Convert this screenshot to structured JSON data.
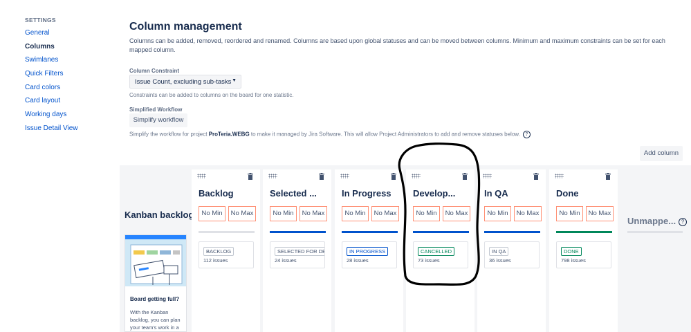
{
  "sidebar": {
    "heading": "SETTINGS",
    "items": [
      {
        "label": "General"
      },
      {
        "label": "Columns"
      },
      {
        "label": "Swimlanes"
      },
      {
        "label": "Quick Filters"
      },
      {
        "label": "Card colors"
      },
      {
        "label": "Card layout"
      },
      {
        "label": "Working days"
      },
      {
        "label": "Issue Detail View"
      }
    ]
  },
  "page": {
    "title": "Column management",
    "description": "Columns can be added, removed, reordered and renamed. Columns are based upon global statuses and can be moved between columns. Minimum and maximum constraints can be set for each mapped column."
  },
  "constraint": {
    "label": "Column Constraint",
    "selected": "Issue Count, excluding sub-tasks",
    "arrow": "▼",
    "hint": "Constraints can be added to columns on the board for one statistic."
  },
  "workflow": {
    "label": "Simplified Workflow",
    "button": "Simplify workflow",
    "hint_before": "Simplify the workflow for project ",
    "project": "ProTeria.WEBG",
    "hint_after": " to make it managed by Jira Software. This will allow Project Administrators to add and remove statuses below.",
    "help": "?"
  },
  "add_column": "Add column",
  "backlog": {
    "title": "Kanban backlog",
    "card_title": "Board getting full?",
    "card_text": "With the Kanban backlog, you can plan your team's work in a"
  },
  "min_label": "No Min",
  "max_label": "No Max",
  "columns": [
    {
      "name": "Backlog",
      "status": "BACKLOG",
      "count": "112 issues",
      "bar_color": "#dfe1e6",
      "lozenge_color": "#42526e"
    },
    {
      "name": "Selected ...",
      "status": "SELECTED FOR DEVELOPMENT",
      "count": "24 issues",
      "bar_color": "#0052cc",
      "lozenge_color": "#42526e"
    },
    {
      "name": "In Progress",
      "status": "IN PROGRESS",
      "count": "28 issues",
      "bar_color": "#0052cc",
      "lozenge_color": "#0052cc"
    },
    {
      "name": "Develop...",
      "status": "CANCELLED",
      "count": "73 issues",
      "bar_color": "#0052cc",
      "lozenge_color": "#00875a"
    },
    {
      "name": "In QA",
      "status": "IN QA",
      "count": "36 issues",
      "bar_color": "#0052cc",
      "lozenge_color": "#42526e"
    },
    {
      "name": "Done",
      "status": "DONE",
      "count": "798 issues",
      "bar_color": "#00875a",
      "lozenge_color": "#00875a"
    }
  ],
  "unmapped": {
    "title": "Unmappe...",
    "help": "?"
  }
}
